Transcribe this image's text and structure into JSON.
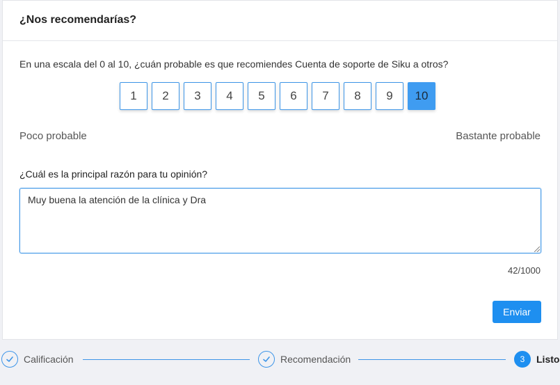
{
  "card": {
    "title": "¿Nos recomendarías?",
    "question": "En una escala del 0 al 10, ¿cuán probable es que recomiendes Cuenta de soporte de Siku a otros?",
    "scale": {
      "options": [
        "1",
        "2",
        "3",
        "4",
        "5",
        "6",
        "7",
        "8",
        "9",
        "10"
      ],
      "selected": "10",
      "low_label": "Poco probable",
      "high_label": "Bastante probable"
    },
    "reason": {
      "question": "¿Cuál es la principal razón para tu opinión?",
      "value": "Muy buena la atención de la clínica y Dra ",
      "counter": "42/1000"
    },
    "send_label": "Enviar"
  },
  "stepper": {
    "steps": [
      {
        "label": "Calificación",
        "state": "done"
      },
      {
        "label": "Recomendación",
        "state": "done"
      },
      {
        "label": "Listo",
        "state": "active",
        "number": "3"
      }
    ]
  },
  "colors": {
    "accent": "#1e8ff0",
    "selected_scale": "#3f9cf1",
    "background": "#f0f1f5"
  }
}
